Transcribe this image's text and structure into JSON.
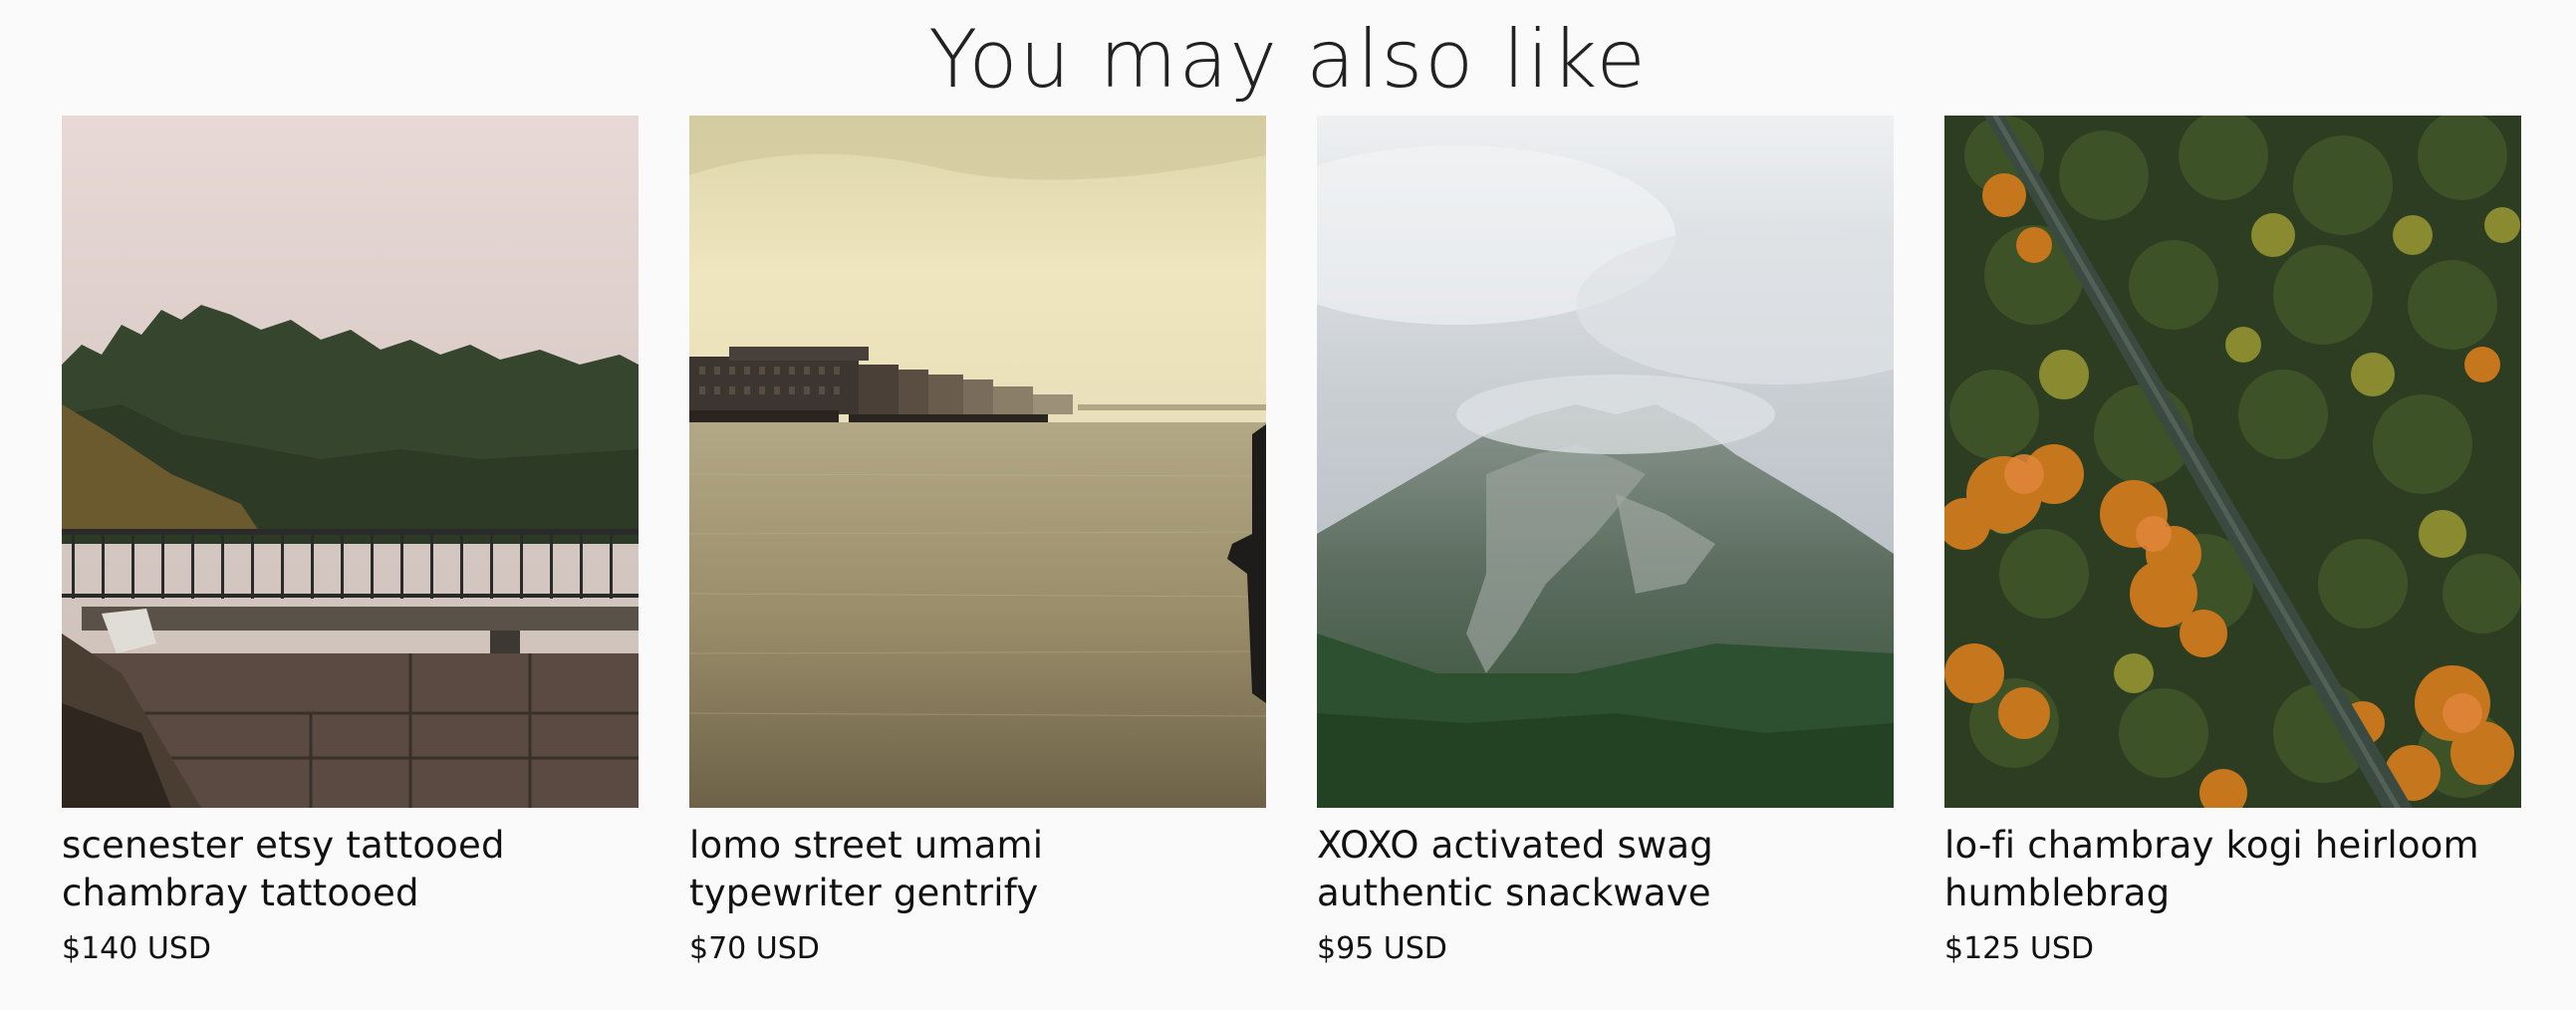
{
  "section": {
    "title": "You may also like"
  },
  "products": [
    {
      "name": "scenester etsy tattooed chambray tattooed",
      "price": "$140 USD",
      "image_alt": "misty-forest-balcony-image"
    },
    {
      "name": "lomo street umami typewriter gentrify",
      "price": "$70 USD",
      "image_alt": "river-city-skyline-image"
    },
    {
      "name": "XOXO activated swag authentic snackwave",
      "price": "$95 USD",
      "image_alt": "foggy-mountain-image"
    },
    {
      "name": "lo-fi chambray kogi heirloom humblebrag",
      "price": "$125 USD",
      "image_alt": "autumn-forest-aerial-image"
    }
  ]
}
